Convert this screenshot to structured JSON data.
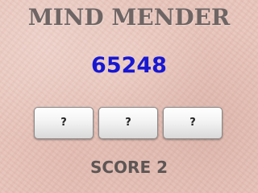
{
  "game": {
    "title": "MIND MENDER",
    "number": "65248",
    "answers": [
      "?",
      "?",
      "?"
    ],
    "score_label": "SCORE",
    "score_value": "2"
  },
  "colors": {
    "title": "#6e6564",
    "number": "#1717d2",
    "score": "#5d5655",
    "background": "#e8c5bb"
  }
}
